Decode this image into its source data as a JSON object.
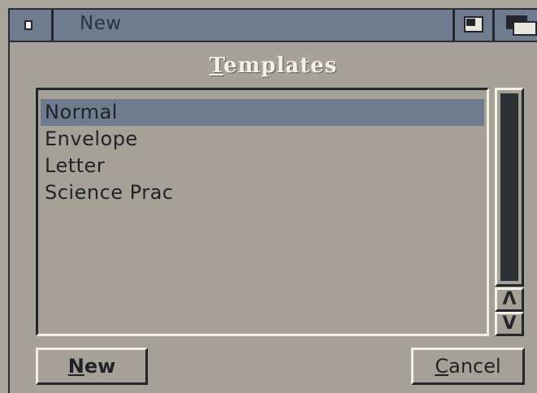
{
  "window": {
    "title": "New"
  },
  "heading": {
    "first": "T",
    "rest": "emplates"
  },
  "templates": {
    "items": [
      {
        "label": "Normal",
        "selected": true
      },
      {
        "label": "Envelope",
        "selected": false
      },
      {
        "label": "Letter",
        "selected": false
      },
      {
        "label": "Science Prac",
        "selected": false
      }
    ]
  },
  "scroll": {
    "up_glyph": "Λ",
    "down_glyph": "V"
  },
  "buttons": {
    "new_first": "N",
    "new_rest": "ew",
    "cancel_first": "C",
    "cancel_rest": "ancel"
  },
  "colors": {
    "titlebar": "#6f7c90",
    "background": "#a7a297",
    "selection": "#6f7c90",
    "shadow": "#23262c",
    "highlight": "#f2efe4"
  },
  "icons": {
    "close": "close-gadget-icon",
    "zoom": "zoom-gadget-icon",
    "depth": "depth-gadget-icon",
    "scroll_up": "arrow-up-icon",
    "scroll_down": "arrow-down-icon"
  }
}
